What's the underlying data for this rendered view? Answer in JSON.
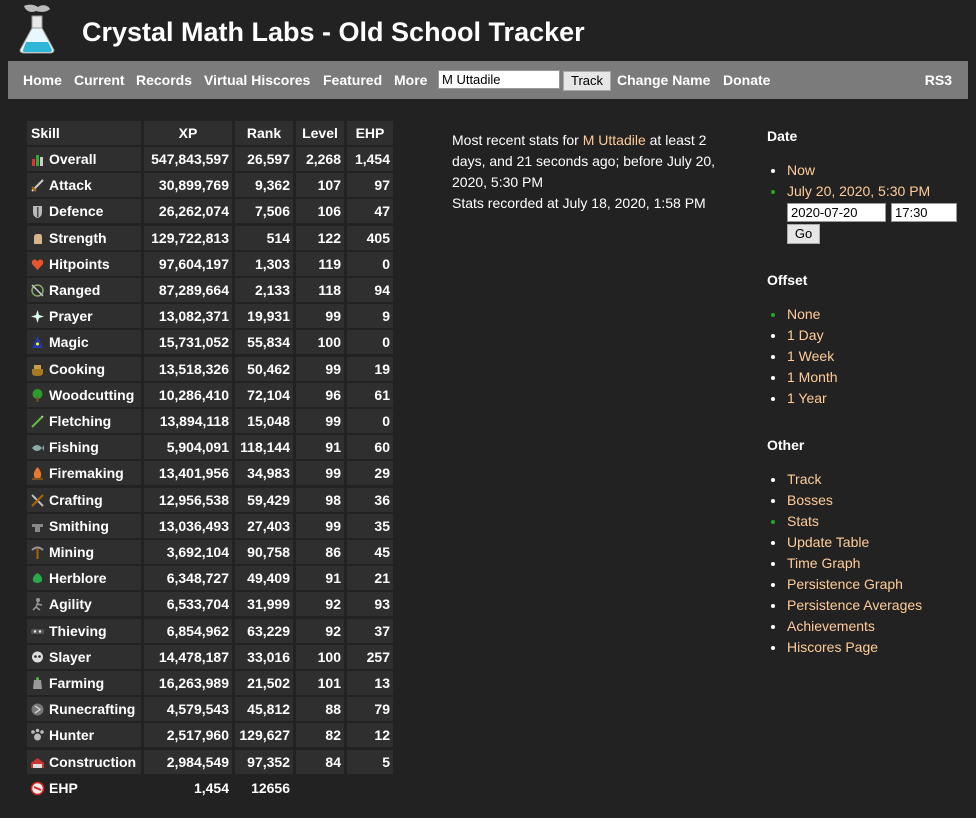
{
  "site": {
    "title": "Crystal Math Labs - Old School Tracker"
  },
  "nav": {
    "links": [
      "Home",
      "Current",
      "Records",
      "Virtual Hiscores",
      "Featured",
      "More"
    ],
    "search_value": "M Uttadile",
    "track_label": "Track",
    "links_right": [
      "Change Name",
      "Donate"
    ],
    "rs3": "RS3"
  },
  "table": {
    "headers": [
      "Skill",
      "XP",
      "Rank",
      "Level",
      "EHP"
    ],
    "rows": [
      {
        "skill": "Overall",
        "icon": "overall-icon",
        "xp": "547,843,597",
        "rank": "26,597",
        "level": "2,268",
        "ehp": "1,454"
      },
      {
        "skill": "Attack",
        "icon": "attack-icon",
        "xp": "30,899,769",
        "rank": "9,362",
        "level": "107",
        "ehp": "97"
      },
      {
        "skill": "Defence",
        "icon": "defence-icon",
        "xp": "26,262,074",
        "rank": "7,506",
        "level": "106",
        "ehp": "47"
      },
      {
        "skill": "Strength",
        "icon": "strength-icon",
        "xp": "129,722,813",
        "rank": "514",
        "level": "122",
        "ehp": "405"
      },
      {
        "skill": "Hitpoints",
        "icon": "hitpoints-icon",
        "xp": "97,604,197",
        "rank": "1,303",
        "level": "119",
        "ehp": "0"
      },
      {
        "skill": "Ranged",
        "icon": "ranged-icon",
        "xp": "87,289,664",
        "rank": "2,133",
        "level": "118",
        "ehp": "94"
      },
      {
        "skill": "Prayer",
        "icon": "prayer-icon",
        "xp": "13,082,371",
        "rank": "19,931",
        "level": "99",
        "ehp": "9"
      },
      {
        "skill": "Magic",
        "icon": "magic-icon",
        "xp": "15,731,052",
        "rank": "55,834",
        "level": "100",
        "ehp": "0"
      },
      {
        "skill": "Cooking",
        "icon": "cooking-icon",
        "xp": "13,518,326",
        "rank": "50,462",
        "level": "99",
        "ehp": "19"
      },
      {
        "skill": "Woodcutting",
        "icon": "woodcutting-icon",
        "xp": "10,286,410",
        "rank": "72,104",
        "level": "96",
        "ehp": "61"
      },
      {
        "skill": "Fletching",
        "icon": "fletching-icon",
        "xp": "13,894,118",
        "rank": "15,048",
        "level": "99",
        "ehp": "0"
      },
      {
        "skill": "Fishing",
        "icon": "fishing-icon",
        "xp": "5,904,091",
        "rank": "118,144",
        "level": "91",
        "ehp": "60"
      },
      {
        "skill": "Firemaking",
        "icon": "firemaking-icon",
        "xp": "13,401,956",
        "rank": "34,983",
        "level": "99",
        "ehp": "29"
      },
      {
        "skill": "Crafting",
        "icon": "crafting-icon",
        "xp": "12,956,538",
        "rank": "59,429",
        "level": "98",
        "ehp": "36"
      },
      {
        "skill": "Smithing",
        "icon": "smithing-icon",
        "xp": "13,036,493",
        "rank": "27,403",
        "level": "99",
        "ehp": "35"
      },
      {
        "skill": "Mining",
        "icon": "mining-icon",
        "xp": "3,692,104",
        "rank": "90,758",
        "level": "86",
        "ehp": "45"
      },
      {
        "skill": "Herblore",
        "icon": "herblore-icon",
        "xp": "6,348,727",
        "rank": "49,409",
        "level": "91",
        "ehp": "21"
      },
      {
        "skill": "Agility",
        "icon": "agility-icon",
        "xp": "6,533,704",
        "rank": "31,999",
        "level": "92",
        "ehp": "93"
      },
      {
        "skill": "Thieving",
        "icon": "thieving-icon",
        "xp": "6,854,962",
        "rank": "63,229",
        "level": "92",
        "ehp": "37"
      },
      {
        "skill": "Slayer",
        "icon": "slayer-icon",
        "xp": "14,478,187",
        "rank": "33,016",
        "level": "100",
        "ehp": "257"
      },
      {
        "skill": "Farming",
        "icon": "farming-icon",
        "xp": "16,263,989",
        "rank": "21,502",
        "level": "101",
        "ehp": "13"
      },
      {
        "skill": "Runecrafting",
        "icon": "runecrafting-icon",
        "xp": "4,579,543",
        "rank": "45,812",
        "level": "88",
        "ehp": "79"
      },
      {
        "skill": "Hunter",
        "icon": "hunter-icon",
        "xp": "2,517,960",
        "rank": "129,627",
        "level": "82",
        "ehp": "12"
      },
      {
        "skill": "Construction",
        "icon": "construction-icon",
        "xp": "2,984,549",
        "rank": "97,352",
        "level": "84",
        "ehp": "5"
      }
    ],
    "ehp_row": {
      "skill": "EHP",
      "icon": "ehp-icon",
      "xp": "1,454",
      "rank": "12656"
    }
  },
  "recent": {
    "prefix": "Most recent stats for",
    "player": "M Uttadile",
    "suffix": "at least 2 days, and 21 seconds ago; before July 20, 2020, 5:30 PM",
    "recorded": "Stats recorded at July 18, 2020, 1:58 PM"
  },
  "sidebar": {
    "date": {
      "heading": "Date",
      "items": [
        {
          "label": "Now",
          "active": false
        },
        {
          "label": "July 20, 2020, 5:30 PM",
          "active": true
        }
      ],
      "date_value": "2020-07-20",
      "time_value": "17:30",
      "go_label": "Go"
    },
    "offset": {
      "heading": "Offset",
      "items": [
        {
          "label": "None",
          "active": true
        },
        {
          "label": "1 Day",
          "active": false
        },
        {
          "label": "1 Week",
          "active": false
        },
        {
          "label": "1 Month",
          "active": false
        },
        {
          "label": "1 Year",
          "active": false
        }
      ]
    },
    "other": {
      "heading": "Other",
      "items": [
        {
          "label": "Track",
          "active": false
        },
        {
          "label": "Bosses",
          "active": false
        },
        {
          "label": "Stats",
          "active": true
        },
        {
          "label": "Update Table",
          "active": false
        },
        {
          "label": "Time Graph",
          "active": false
        },
        {
          "label": "Persistence Graph",
          "active": false
        },
        {
          "label": "Persistence Averages",
          "active": false
        },
        {
          "label": "Achievements",
          "active": false
        },
        {
          "label": "Hiscores Page",
          "active": false
        }
      ]
    }
  },
  "colors": {
    "background": "#222222",
    "nav_bar": "#7b7b7b",
    "cell": "#2f2f2f",
    "link_accent": "#ffcc99",
    "active_bullet": "#22aa22"
  }
}
